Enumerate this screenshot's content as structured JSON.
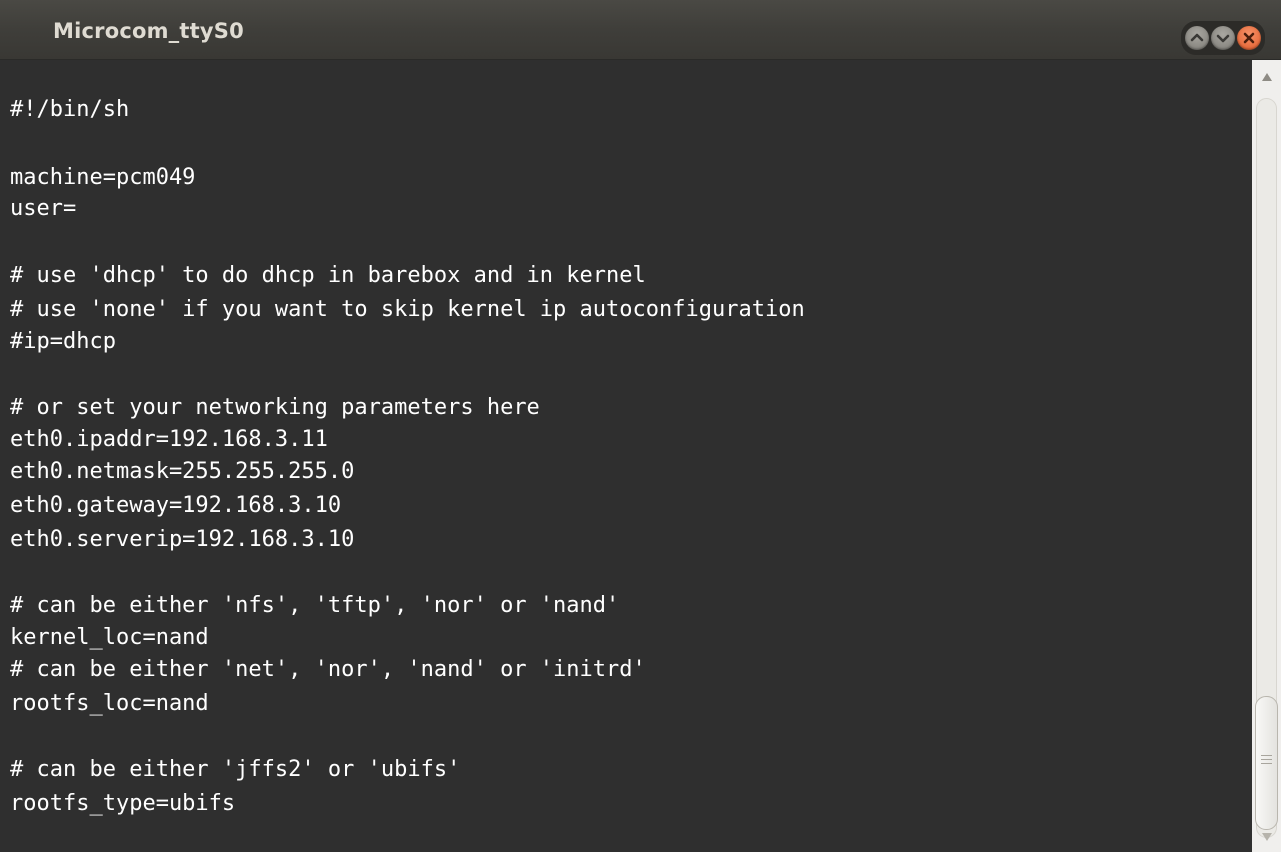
{
  "window": {
    "title": "Microcom_ttyS0"
  },
  "window_controls": {
    "minimize_icon": "minimize-icon",
    "maximize_icon": "maximize-icon",
    "close_icon": "close-icon"
  },
  "terminal": {
    "lines": [
      "#!/bin/sh",
      "machine=pcm049",
      "user=",
      "# use 'dhcp' to do dhcp in barebox and in kernel",
      "# use 'none' if you want to skip kernel ip autoconfiguration",
      "#ip=dhcp",
      "# or set your networking parameters here",
      "eth0.ipaddr=192.168.3.11",
      "eth0.netmask=255.255.255.0",
      "eth0.gateway=192.168.3.10",
      "eth0.serverip=192.168.3.10",
      "# can be either 'nfs', 'tftp', 'nor' or 'nand'",
      "kernel_loc=nand",
      "# can be either 'net', 'nor', 'nand' or 'initrd'",
      "rootfs_loc=nand",
      "# can be either 'jffs2' or 'ubifs'",
      "rootfs_type=ubifs"
    ]
  },
  "colors": {
    "terminal_bg": "#2f2f2f",
    "text": "#ffffff",
    "titlebar_text": "#dfdbd2",
    "close_button": "#e05a28"
  }
}
